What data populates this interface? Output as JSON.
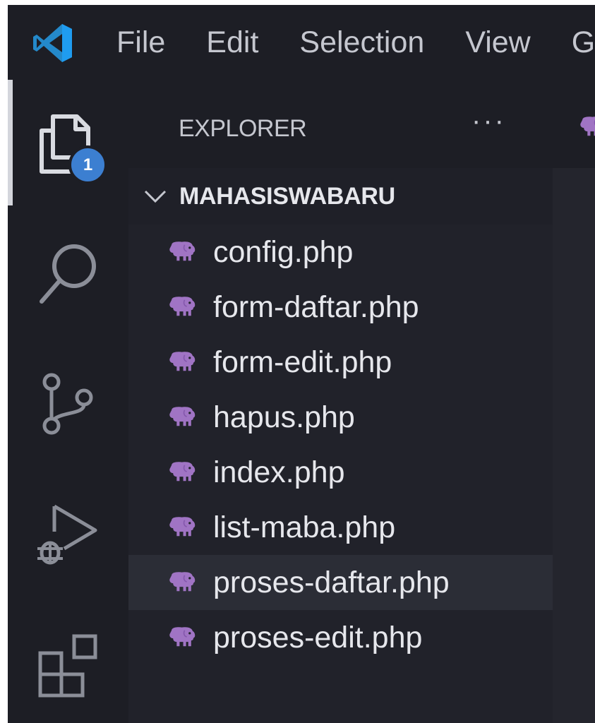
{
  "app": {
    "logo_icon": "vscode-logo-icon"
  },
  "menu": [
    {
      "label": "File"
    },
    {
      "label": "Edit"
    },
    {
      "label": "Selection"
    },
    {
      "label": "View"
    },
    {
      "label": "G"
    }
  ],
  "activity_bar": {
    "items": [
      {
        "icon": "files-icon",
        "active": true,
        "badge": "1"
      },
      {
        "icon": "search-icon"
      },
      {
        "icon": "source-control-icon"
      },
      {
        "icon": "run-debug-icon"
      },
      {
        "icon": "extensions-icon"
      }
    ]
  },
  "sidebar": {
    "title": "EXPLORER",
    "more_actions": "···",
    "folder": {
      "name": "MAHASISWABARU",
      "expanded": true
    },
    "files": [
      {
        "name": "config.php",
        "icon": "php-elephant-icon"
      },
      {
        "name": "form-daftar.php",
        "icon": "php-elephant-icon"
      },
      {
        "name": "form-edit.php",
        "icon": "php-elephant-icon"
      },
      {
        "name": "hapus.php",
        "icon": "php-elephant-icon"
      },
      {
        "name": "index.php",
        "icon": "php-elephant-icon"
      },
      {
        "name": "list-maba.php",
        "icon": "php-elephant-icon"
      },
      {
        "name": "proses-daftar.php",
        "icon": "php-elephant-icon",
        "selected": true
      },
      {
        "name": "proses-edit.php",
        "icon": "php-elephant-icon"
      }
    ]
  },
  "colors": {
    "accent_badge": "#3c7fd1",
    "php_icon": "#a074c4",
    "logo": "#2489ca"
  }
}
